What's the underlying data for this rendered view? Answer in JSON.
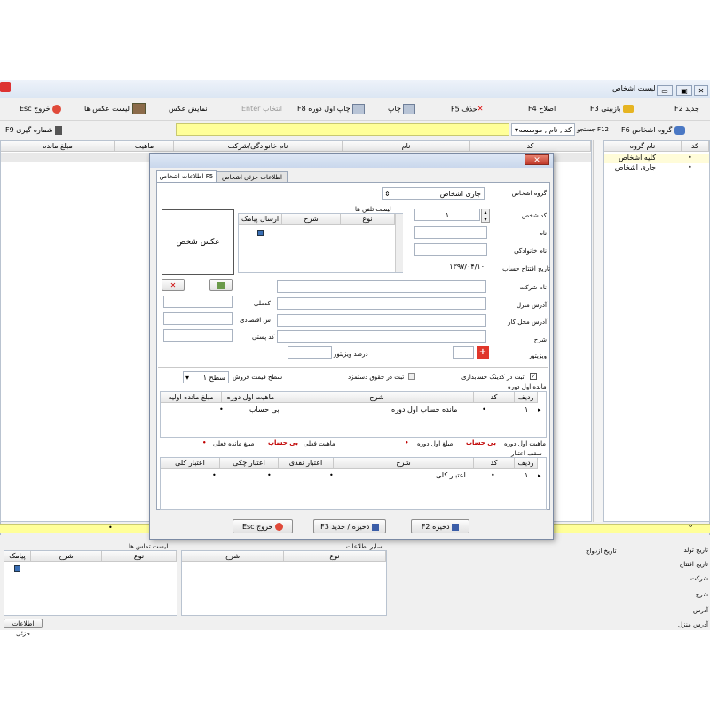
{
  "window": {
    "title": "لیست اشخاص",
    "min": "▭",
    "restore": "▣",
    "close": "✕"
  },
  "toolbar": {
    "new": "جدید F2",
    "refresh": "بازبینی F3",
    "edit": "اصلاح F4",
    "delete": "حذف F5",
    "print": "چاپ",
    "print_opening": "چاپ اول دوره F8",
    "select_enter": "انتخاب Enter",
    "show_photo": "نمایش عکس",
    "photo_list": "لیست عکس ها",
    "exit": "خروج Esc"
  },
  "bar2": {
    "group": "گروه اشخاص F6",
    "search": "F12 جستجو",
    "search_mode": "کد , نام , موسسه",
    "count": "شماره گیری F9"
  },
  "main_table": {
    "headers": [
      "کد",
      "نام",
      "نام خانوادگی/شرکت",
      "ماهیت",
      "مبلغ مانده"
    ]
  },
  "group_table": {
    "headers": [
      "کد",
      "نام گروه"
    ],
    "rows": [
      {
        "code": "•",
        "name": "کلیه اشخاص"
      },
      {
        "code": "•",
        "name": "جاری اشخاص"
      }
    ]
  },
  "footer": {
    "count": "۲",
    "dot": "•"
  },
  "dialog": {
    "tabs": [
      "اطلاعات اشخاص F5",
      "اطلاعات جزئی اشخاص F6"
    ],
    "person_group_label": "گروه اشخاص",
    "person_group_value": "جاری اشخاص",
    "code_label": "کد شخص",
    "code_value": "۱",
    "name_label": "نام",
    "family_label": "نام خانوادگی",
    "open_date_label": "تاریخ افتتاح حساب",
    "open_date_value": "۱۳۹۷/۰۴/۱۰",
    "company_label": "نام شرکت",
    "home_addr_label": "آدرس منزل",
    "work_addr_label": "آدرس محل کار",
    "desc_label": "شرح",
    "visitor_label": "ویزیتور",
    "visitor_pct_label": "درصد ویزیتور",
    "national_id_label": "کدملی",
    "econ_no_label": "ش اقتصادی",
    "postal_label": "کد پستی",
    "photo_label": "عکس شخص",
    "phones_title": "لیست تلفن ها",
    "phones_headers": [
      "نوع",
      "شرح",
      "ارسال پیامک"
    ],
    "acc_code_check": "ثبت در کدینگ حسابداری",
    "payroll_check": "ثبت در حقوق دستمزد",
    "price_level_label": "سطح قیمت فروش",
    "price_level_value": "سطح ۱",
    "opening_title": "مانده اول دوره",
    "opening_headers": [
      "ردیف",
      "کد",
      "شرح",
      "ماهیت اول دوره",
      "مبلغ مانده اولیه"
    ],
    "opening_row": {
      "row": "۱",
      "code": "•",
      "desc": "مانده حساب اول دوره",
      "nature": "بی حساب",
      "amount": "•"
    },
    "summary": {
      "nature_opening_label": "ماهیت اول دوره",
      "nature_opening_value": "بی حساب",
      "amount_opening_label": "مبلغ اول دوره",
      "amount_opening_value": "•",
      "nature_current_label": "ماهیت فعلی",
      "nature_current_value": "بی حساب",
      "amount_current_label": "مبلغ مانده فعلی",
      "amount_current_value": "•"
    },
    "credit_title": "سقف اعتبار",
    "credit_headers": [
      "ردیف",
      "کد",
      "شرح",
      "اعتبار نقدی",
      "اعتبار چکی",
      "اعتبار کلی"
    ],
    "credit_row": {
      "row": "۱",
      "code": "•",
      "desc": "اعتبار کلی",
      "cash": "•",
      "cheque": "•",
      "total": "•"
    },
    "save_btn": "ذخیره F2",
    "save_new_btn": "ذخیره / جدید F3",
    "exit_btn": "خروج Esc"
  },
  "bottom": {
    "contacts_title": "لیست تماس ها",
    "contacts_headers": [
      "نوع",
      "شرح",
      "پیامک"
    ],
    "other_title": "سایر اطلاعات",
    "other_headers": [
      "نوع",
      "شرح"
    ],
    "labels": [
      "تاریخ تولد",
      "تاریخ افتتاح",
      "شرکت",
      "شرح",
      "آدرس",
      "آدرس منزل"
    ],
    "marriage_label": "تاریخ ازدواج",
    "details_tab": "اطلاعات جزئی"
  }
}
